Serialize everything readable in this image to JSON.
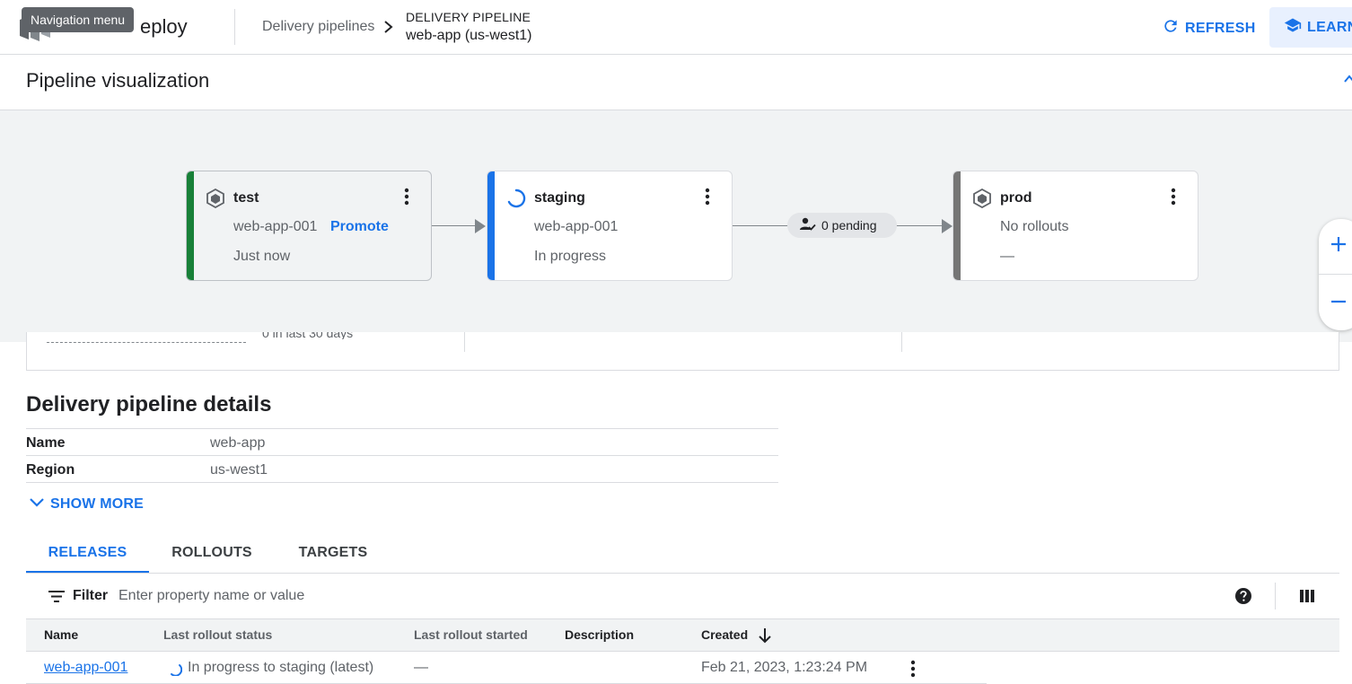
{
  "header": {
    "app_title": "eploy",
    "tooltip": "Navigation menu",
    "breadcrumb": "Delivery pipelines",
    "pipeline_kicker": "DELIVERY PIPELINE",
    "pipeline_name": "web-app (us-west1)",
    "refresh_label": "REFRESH",
    "learn_label": "LEARN"
  },
  "visualization": {
    "title": "Pipeline visualization",
    "stages": [
      {
        "name": "test",
        "release": "web-app-001",
        "status": "Just now",
        "action": "Promote",
        "bar_color": "#188038",
        "icon": "target-icon"
      },
      {
        "name": "staging",
        "release": "web-app-001",
        "status": "In progress",
        "bar_color": "#1a73e8",
        "icon": "spinner-icon"
      },
      {
        "name": "prod",
        "release": "No rollouts",
        "status": "—",
        "bar_color": "#757575",
        "icon": "target-icon"
      }
    ],
    "pending_label": "0 pending"
  },
  "metrics": {
    "partial_text": "0 in last 30 days"
  },
  "details": {
    "title": "Delivery pipeline details",
    "rows": [
      {
        "key": "Name",
        "value": "web-app"
      },
      {
        "key": "Region",
        "value": "us-west1"
      }
    ],
    "show_more": "SHOW MORE"
  },
  "tabs": [
    {
      "label": "RELEASES",
      "active": true
    },
    {
      "label": "ROLLOUTS",
      "active": false
    },
    {
      "label": "TARGETS",
      "active": false
    }
  ],
  "filter": {
    "label": "Filter",
    "placeholder": "Enter property name or value"
  },
  "table": {
    "columns": [
      "Name",
      "Last rollout status",
      "Last rollout started",
      "Description",
      "Created"
    ],
    "rows": [
      {
        "name": "web-app-001",
        "status": "In progress to staging (latest)",
        "started": "—",
        "description": "",
        "created": "Feb 21, 2023, 1:23:24 PM"
      }
    ]
  },
  "colors": {
    "accent": "#1a73e8",
    "success": "#188038",
    "neutral": "#757575"
  }
}
